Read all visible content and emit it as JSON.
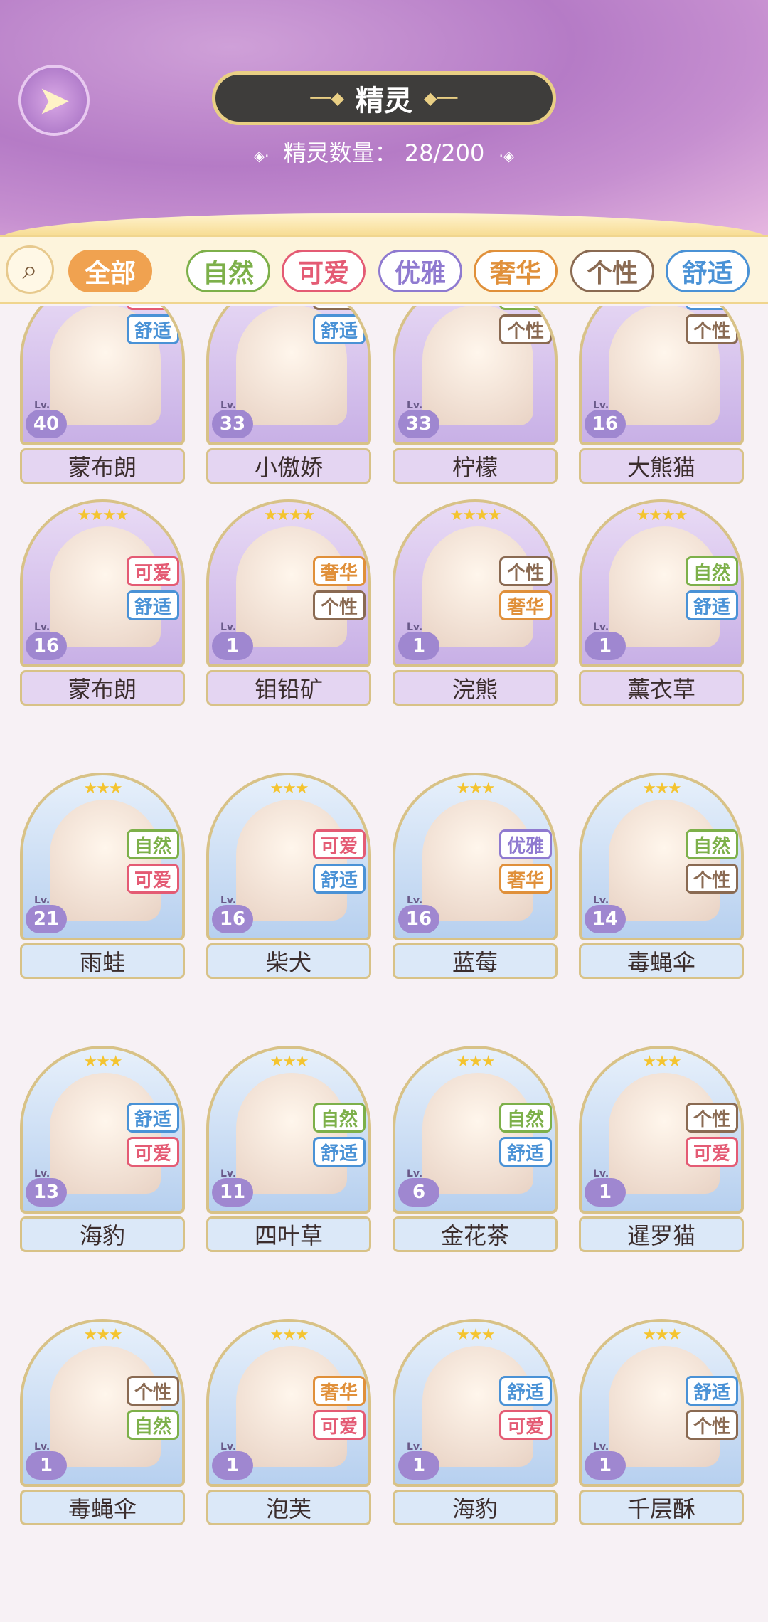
{
  "header": {
    "back_icon": "back-wing-icon",
    "title": "精灵",
    "count_label": "精灵数量：",
    "count_value": "28/200"
  },
  "filters": {
    "search_icon": "search-icon",
    "tabs": [
      {
        "label": "全部",
        "color": "#f0a250"
      },
      {
        "label": "自然",
        "color": "#7db04a"
      },
      {
        "label": "可爱",
        "color": "#e45b74"
      },
      {
        "label": "优雅",
        "color": "#8f7ad0"
      },
      {
        "label": "奢华",
        "color": "#e0903a"
      },
      {
        "label": "个性",
        "color": "#8a6a52"
      },
      {
        "label": "舒适",
        "color": "#4a92d6"
      }
    ]
  },
  "tag_colors": {
    "可爱": "#e45b74",
    "舒适": "#4a92d6",
    "个性": "#8a6a52",
    "自然": "#7db04a",
    "奢华": "#e0903a",
    "优雅": "#8f7ad0"
  },
  "cards": [
    {
      "name": "蒙布朗",
      "level": "40",
      "tags": [
        "可爱",
        "舒适"
      ],
      "stars": "",
      "theme": "purple"
    },
    {
      "name": "小傲娇",
      "level": "33",
      "tags": [
        "个性",
        "舒适"
      ],
      "stars": "",
      "theme": "purple"
    },
    {
      "name": "柠檬",
      "level": "33",
      "tags": [
        "自然",
        "个性"
      ],
      "stars": "",
      "theme": "purple"
    },
    {
      "name": "大熊猫",
      "level": "16",
      "tags": [
        "舒适",
        "个性"
      ],
      "stars": "",
      "theme": "purple"
    },
    {
      "name": "蒙布朗",
      "level": "16",
      "tags": [
        "可爱",
        "舒适"
      ],
      "stars": "★★★★",
      "theme": "purple"
    },
    {
      "name": "钼铅矿",
      "level": "1",
      "tags": [
        "奢华",
        "个性"
      ],
      "stars": "★★★★",
      "theme": "purple"
    },
    {
      "name": "浣熊",
      "level": "1",
      "tags": [
        "个性",
        "奢华"
      ],
      "stars": "★★★★",
      "theme": "purple"
    },
    {
      "name": "薰衣草",
      "level": "1",
      "tags": [
        "自然",
        "舒适"
      ],
      "stars": "★★★★",
      "theme": "purple"
    },
    {
      "name": "雨蛙",
      "level": "21",
      "tags": [
        "自然",
        "可爱"
      ],
      "stars": "★★★",
      "theme": "blue"
    },
    {
      "name": "柴犬",
      "level": "16",
      "tags": [
        "可爱",
        "舒适"
      ],
      "stars": "★★★",
      "theme": "blue"
    },
    {
      "name": "蓝莓",
      "level": "16",
      "tags": [
        "优雅",
        "奢华"
      ],
      "stars": "★★★",
      "theme": "blue"
    },
    {
      "name": "毒蝇伞",
      "level": "14",
      "tags": [
        "自然",
        "个性"
      ],
      "stars": "★★★",
      "theme": "blue"
    },
    {
      "name": "海豹",
      "level": "13",
      "tags": [
        "舒适",
        "可爱"
      ],
      "stars": "★★★",
      "theme": "blue"
    },
    {
      "name": "四叶草",
      "level": "11",
      "tags": [
        "自然",
        "舒适"
      ],
      "stars": "★★★",
      "theme": "blue"
    },
    {
      "name": "金花茶",
      "level": "6",
      "tags": [
        "自然",
        "舒适"
      ],
      "stars": "★★★",
      "theme": "blue"
    },
    {
      "name": "暹罗猫",
      "level": "1",
      "tags": [
        "个性",
        "可爱"
      ],
      "stars": "★★★",
      "theme": "blue"
    },
    {
      "name": "毒蝇伞",
      "level": "1",
      "tags": [
        "个性",
        "自然"
      ],
      "stars": "★★★",
      "theme": "blue"
    },
    {
      "name": "泡芙",
      "level": "1",
      "tags": [
        "奢华",
        "可爱"
      ],
      "stars": "★★★",
      "theme": "blue"
    },
    {
      "name": "海豹",
      "level": "1",
      "tags": [
        "舒适",
        "可爱"
      ],
      "stars": "★★★",
      "theme": "blue"
    },
    {
      "name": "千层酥",
      "level": "1",
      "tags": [
        "舒适",
        "个性"
      ],
      "stars": "★★★",
      "theme": "blue"
    }
  ],
  "level_prefix": "Lv."
}
